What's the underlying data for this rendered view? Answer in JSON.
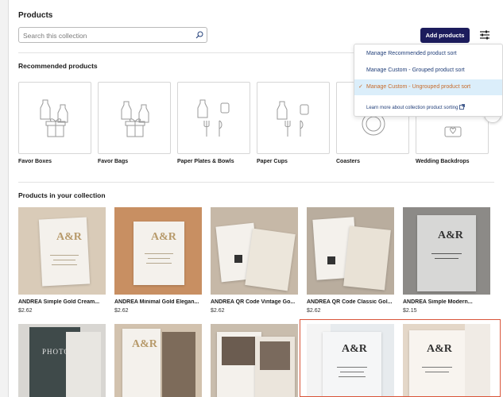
{
  "header": {
    "title": "Products"
  },
  "search": {
    "placeholder": "Search this collection"
  },
  "toolbar": {
    "add_products_label": "Add products"
  },
  "sort_menu": {
    "items": [
      {
        "label": "Manage Recommended product sort",
        "active": false
      },
      {
        "label": "Manage Custom - Grouped product sort",
        "active": false
      },
      {
        "label": "Manage Custom - Ungrouped product sort",
        "active": true
      }
    ],
    "help_link": "Learn more about collection product sorting"
  },
  "recommended": {
    "title": "Recommended products",
    "items": [
      {
        "label": "Favor Boxes",
        "icon": "favor-box-icon"
      },
      {
        "label": "Favor Bags",
        "icon": "favor-bag-icon"
      },
      {
        "label": "Paper Plates & Bowls",
        "icon": "plates-icon"
      },
      {
        "label": "Paper Cups",
        "icon": "cups-icon"
      },
      {
        "label": "Coasters",
        "icon": "coaster-icon"
      },
      {
        "label": "Wedding Backdrops",
        "icon": "backdrop-icon"
      }
    ]
  },
  "collection": {
    "title": "Products in your collection",
    "items": [
      {
        "name": "ANDREA Simple Gold Cream...",
        "price": "$2.62"
      },
      {
        "name": "ANDREA Minimal Gold Elegan...",
        "price": "$2.62"
      },
      {
        "name": "ANDREA QR Code Vintage Go...",
        "price": "$2.62"
      },
      {
        "name": "ANDREA QR Code Classic Gol...",
        "price": "$2.62"
      },
      {
        "name": "ANDREA Simple Modern...",
        "price": "$2.15"
      }
    ],
    "row2_text": {
      "photo_card": "PHOTO"
    }
  },
  "colors": {
    "accent": "#1c1c5c",
    "highlight": "#d9553a",
    "link": "#23407a",
    "active_text": "#c76a2a"
  }
}
